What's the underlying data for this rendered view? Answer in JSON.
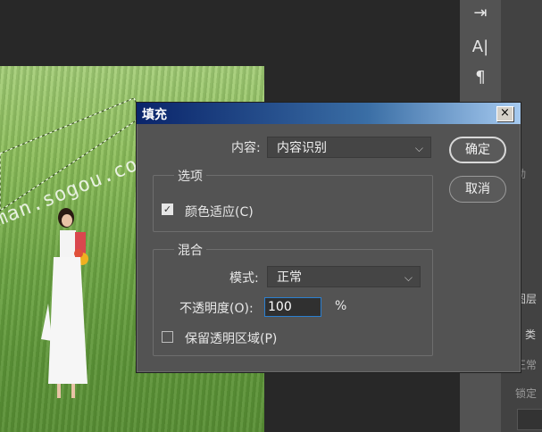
{
  "canvas": {
    "watermark": "man.sogou.co"
  },
  "right_panel": {
    "tools": [
      {
        "icon": "tool-arrow-icon",
        "glyph": "⇥"
      },
      {
        "icon": "character-icon",
        "glyph": "A|"
      },
      {
        "icon": "paragraph-icon",
        "glyph": "¶"
      }
    ],
    "side_labels": [
      "动",
      "图层",
      "P 类",
      "正常",
      "锁定"
    ]
  },
  "dialog": {
    "title": "填充",
    "close_glyph": "×",
    "content_label": "内容:",
    "content_value": "内容识别",
    "ok_label": "确定",
    "cancel_label": "取消",
    "options_group_label": "选项",
    "color_adapt_label": "颜色适应(C)",
    "color_adapt_checked": true,
    "blend_group_label": "混合",
    "mode_label": "模式:",
    "mode_value": "正常",
    "opacity_label": "不透明度(O):",
    "opacity_value": "100",
    "opacity_unit": "%",
    "preserve_label": "保留透明区域(P)",
    "preserve_checked": false
  }
}
